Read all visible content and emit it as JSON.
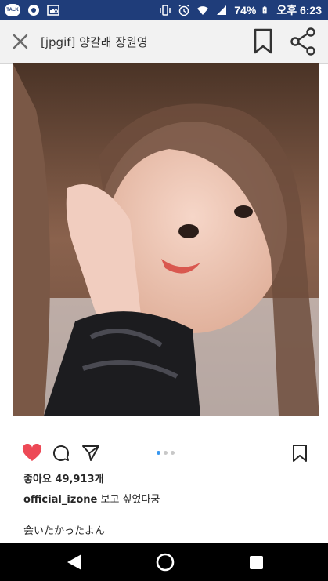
{
  "status_bar": {
    "talk_badge": "TALK",
    "battery_percent": "74%",
    "time": "오후 6:23"
  },
  "app_bar": {
    "title": "[jpgif] 양갈래 장원영"
  },
  "post": {
    "photo_alt": "",
    "carousel": {
      "count": 3,
      "active_index": 0
    },
    "likes_text": "좋아요 49,913개",
    "caption_user": "official_izone",
    "caption_text": " 보고 싶었다궁",
    "comment_text": "会いたかったよん"
  },
  "colors": {
    "status_bar_bg": "#1f3d7a",
    "heart_red": "#ed4956",
    "carousel_active": "#3897f0"
  },
  "icons": {
    "close": "close-icon",
    "bookmark": "bookmark-icon",
    "share": "share-icon",
    "heart": "heart-icon",
    "comment": "comment-icon",
    "send": "send-icon",
    "save": "bookmark-icon",
    "nav_back": "back-triangle-icon",
    "nav_home": "home-circle-icon",
    "nav_recent": "recent-apps-square-icon"
  }
}
